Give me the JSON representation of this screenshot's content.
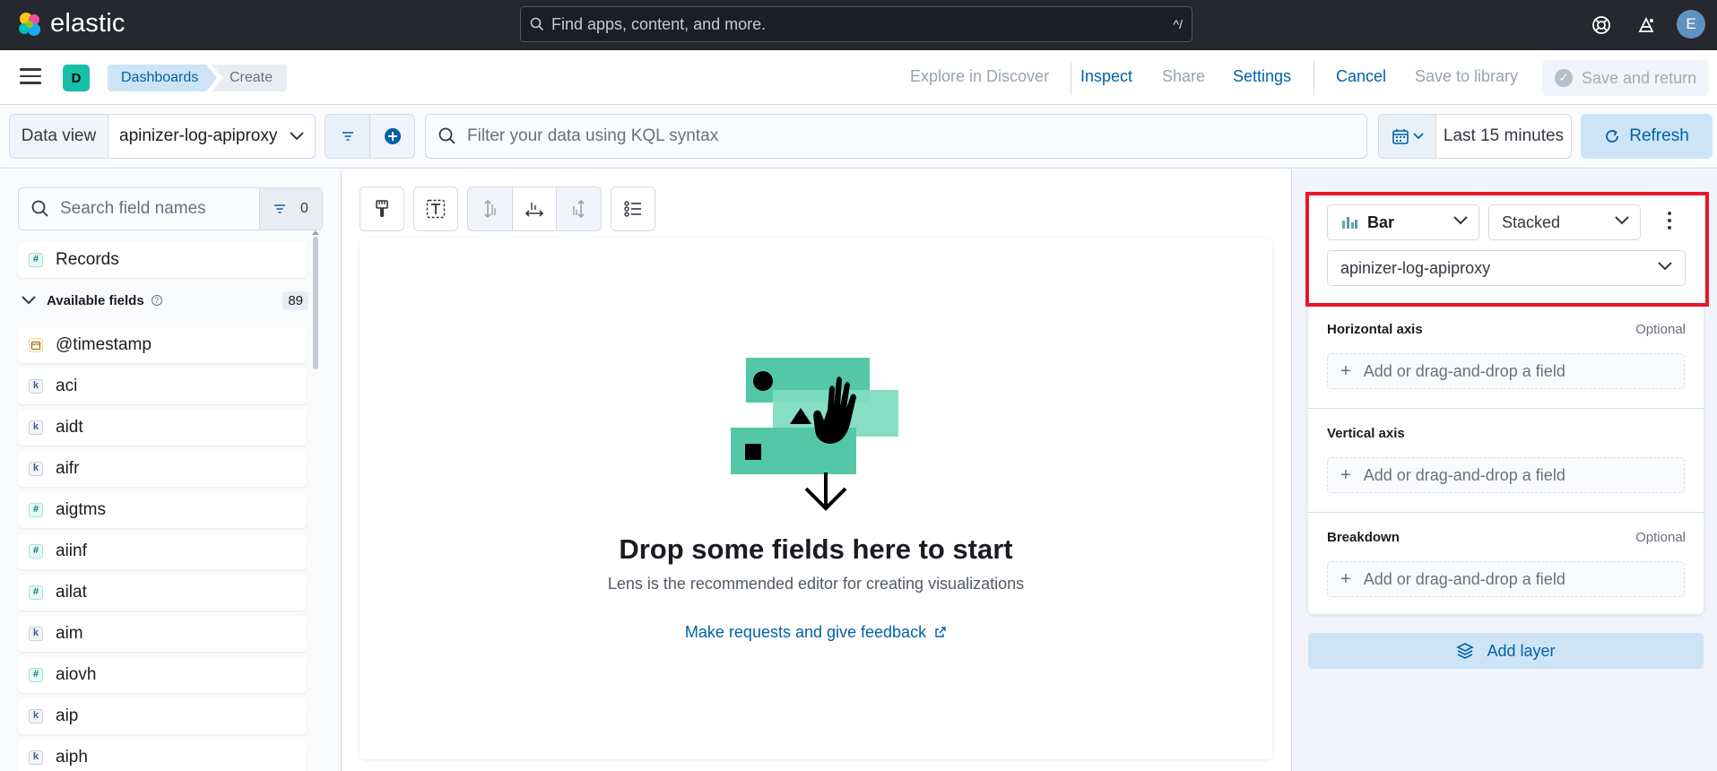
{
  "header": {
    "logo_text": "elastic",
    "search_placeholder": "Find apps, content, and more.",
    "search_shortcut": "^/",
    "avatar_initial": "E"
  },
  "breadcrumbs": {
    "space_initial": "D",
    "items": [
      "Dashboards",
      "Create"
    ]
  },
  "top_actions": {
    "explore": "Explore in Discover",
    "inspect": "Inspect",
    "share": "Share",
    "settings": "Settings",
    "cancel": "Cancel",
    "save_library": "Save to library",
    "save_return": "Save and return"
  },
  "query_bar": {
    "data_view_label": "Data view",
    "data_view_value": "apinizer-log-apiproxy",
    "kql_placeholder": "Filter your data using KQL syntax",
    "time_range": "Last 15 minutes",
    "refresh_label": "Refresh"
  },
  "field_panel": {
    "search_placeholder": "Search field names",
    "filter_count": "0",
    "records_label": "Records",
    "available_label": "Available fields",
    "available_count": "89",
    "fields": [
      {
        "name": "@timestamp",
        "type": "date",
        "token": ""
      },
      {
        "name": "aci",
        "type": "keyword",
        "token": "k"
      },
      {
        "name": "aidt",
        "type": "keyword",
        "token": "k"
      },
      {
        "name": "aifr",
        "type": "keyword",
        "token": "k"
      },
      {
        "name": "aigtms",
        "type": "number",
        "token": "#"
      },
      {
        "name": "aiinf",
        "type": "number",
        "token": "#"
      },
      {
        "name": "ailat",
        "type": "number",
        "token": "#"
      },
      {
        "name": "aim",
        "type": "keyword",
        "token": "k"
      },
      {
        "name": "aiovh",
        "type": "number",
        "token": "#"
      },
      {
        "name": "aip",
        "type": "keyword",
        "token": "k"
      },
      {
        "name": "aiph",
        "type": "keyword",
        "token": "k"
      }
    ]
  },
  "workspace": {
    "empty_title": "Drop some fields here to start",
    "empty_subtitle": "Lens is the recommended editor for creating visualizations",
    "feedback_link": "Make requests and give feedback"
  },
  "config_panel": {
    "chart_type": "Bar",
    "stack_mode": "Stacked",
    "layer_data_view": "apinizer-log-apiproxy",
    "dimensions": [
      {
        "label": "Horizontal axis",
        "optional": "Optional",
        "placeholder": "Add or drag-and-drop a field"
      },
      {
        "label": "Vertical axis",
        "optional": "",
        "placeholder": "Add or drag-and-drop a field"
      },
      {
        "label": "Breakdown",
        "optional": "Optional",
        "placeholder": "Add or drag-and-drop a field"
      }
    ],
    "add_layer": "Add layer"
  },
  "colors": {
    "header_bg": "#25282f",
    "primary": "#0061a6",
    "highlight_border": "#e7162b",
    "illustration_green": "#54c8a6"
  }
}
